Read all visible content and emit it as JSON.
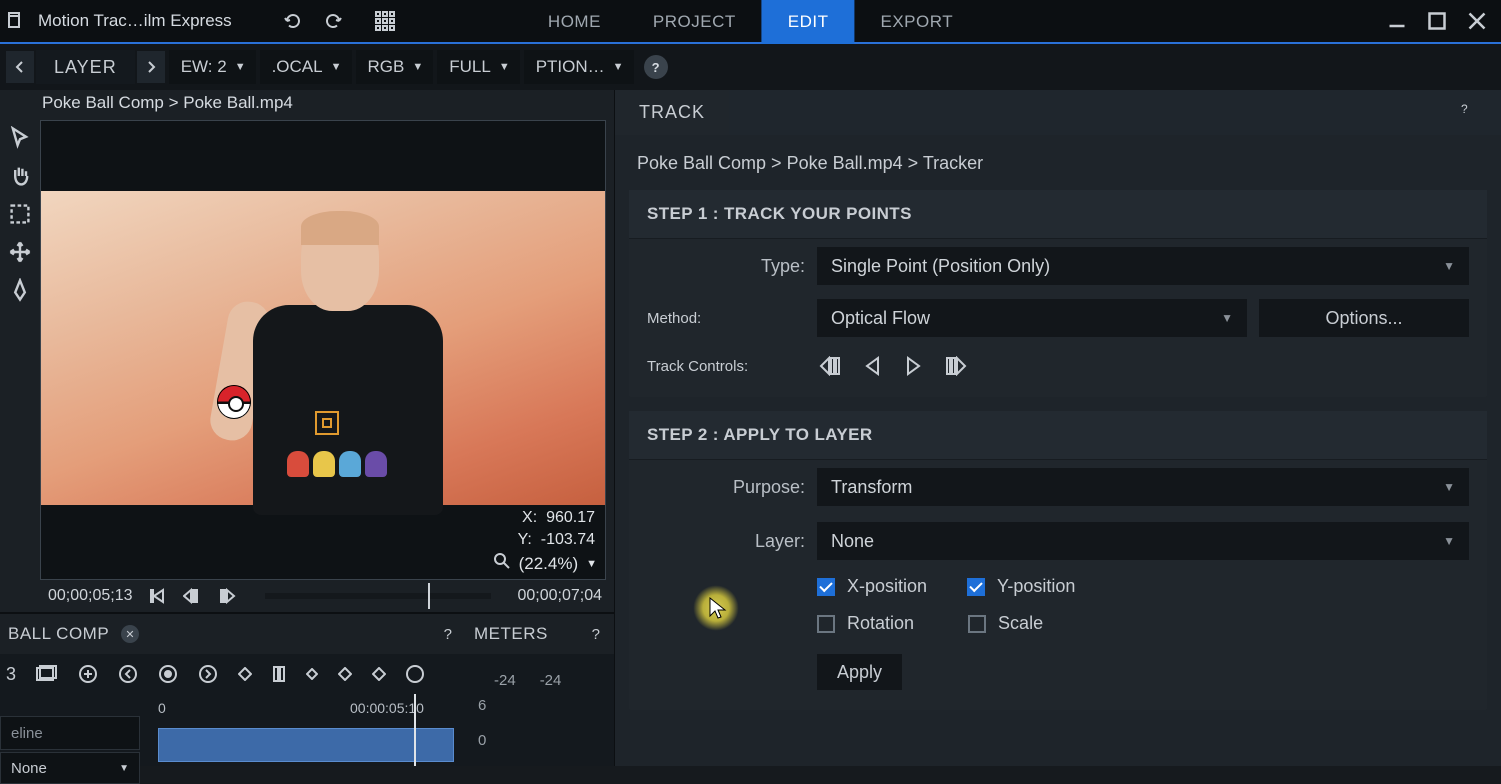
{
  "window": {
    "title": "Motion Trac…ilm Express"
  },
  "mainTabs": {
    "home": "HOME",
    "project": "PROJECT",
    "edit": "EDIT",
    "export": "EXPORT"
  },
  "layerBar": {
    "layer": "LAYER",
    "view": "EW: 2",
    "local": ".OCAL",
    "rgb": "RGB",
    "full": "FULL",
    "options": "PTION…"
  },
  "viewer": {
    "breadcrumb": "Poke Ball Comp > Poke Ball.mp4",
    "x_label": "X:",
    "x_value": "960.17",
    "y_label": "Y:",
    "y_value": "-103.74",
    "zoom": "(22.4%)"
  },
  "timebar": {
    "current": "00;00;05;13",
    "end": "00;00;07;04"
  },
  "compPanel": {
    "tab": "BALL COMP",
    "number": "3",
    "search_placeholder": "eline",
    "ruler_start": "0",
    "ruler_play": "00:00:05:10",
    "none_label": "None"
  },
  "meters": {
    "label": "METERS",
    "db_left": "-24",
    "db_right": "-24",
    "scale_top": "6",
    "scale_next": "0"
  },
  "trackPanel": {
    "tab": "TRACK",
    "breadcrumb": "Poke Ball Comp > Poke Ball.mp4 > Tracker",
    "step1": "STEP 1 : TRACK YOUR POINTS",
    "type_label": "Type:",
    "type_value": "Single Point (Position Only)",
    "method_label": "Method:",
    "method_value": "Optical Flow",
    "options_btn": "Options...",
    "controls_label": "Track Controls:",
    "step2": "STEP 2 : APPLY TO LAYER",
    "purpose_label": "Purpose:",
    "purpose_value": "Transform",
    "layer_label": "Layer:",
    "layer_value": "None",
    "chk_x": "X-position",
    "chk_y": "Y-position",
    "chk_rot": "Rotation",
    "chk_scale": "Scale",
    "apply": "Apply"
  }
}
